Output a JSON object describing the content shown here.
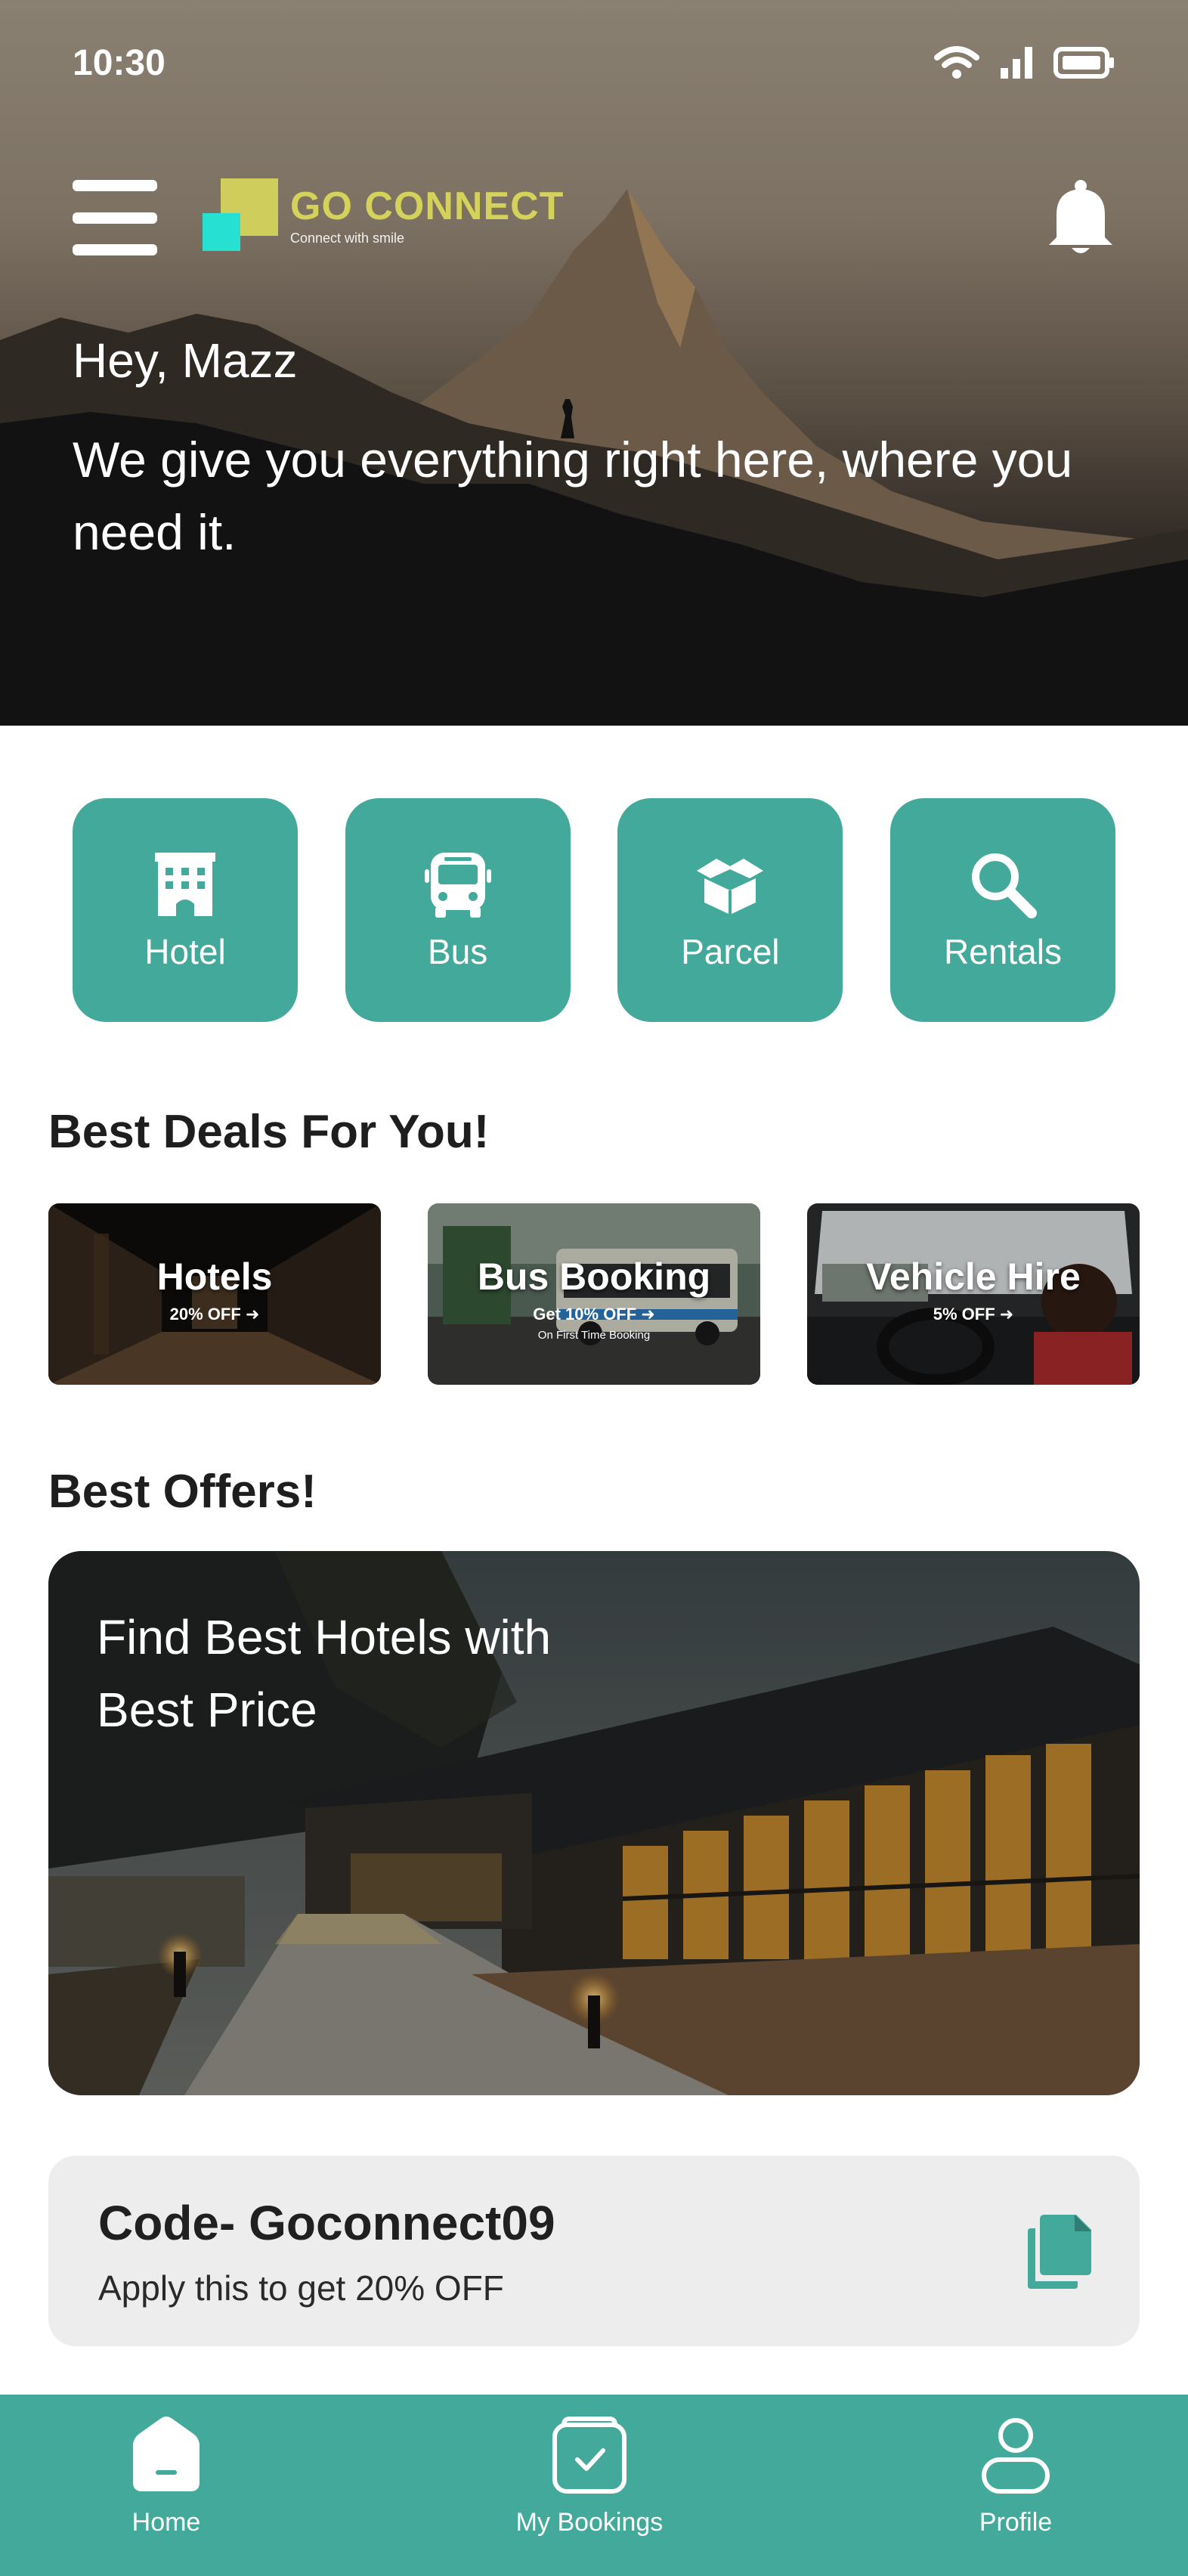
{
  "status_bar": {
    "time": "10:30",
    "icons": [
      "wifi-icon",
      "signal-icon",
      "battery-icon"
    ]
  },
  "header": {
    "logo": {
      "name": "GO CONNECT",
      "tagline": "Connect with smile"
    },
    "greeting": "Hey, Mazz",
    "tagline": "We give you everything right here, where you need it."
  },
  "services": [
    {
      "label": "Hotel",
      "icon": "hotel-icon"
    },
    {
      "label": "Bus",
      "icon": "bus-icon"
    },
    {
      "label": "Parcel",
      "icon": "parcel-icon"
    },
    {
      "label": "Rentals",
      "icon": "search-icon"
    }
  ],
  "deals": {
    "title": "Best Deals For You!",
    "items": [
      {
        "title": "Hotels",
        "subtitle": "20% OFF",
        "note": ""
      },
      {
        "title": "Bus Booking",
        "subtitle": "Get 10% OFF",
        "note": "On First Time Booking"
      },
      {
        "title": "Vehicle Hire",
        "subtitle": "5% OFF",
        "note": ""
      }
    ]
  },
  "offers": {
    "title": "Best Offers!",
    "banner_text": "Find Best Hotels with Best Price"
  },
  "coupon": {
    "code": "Code- Goconnect09",
    "description": "Apply this to get 20% OFF"
  },
  "bottom_nav": [
    {
      "label": "Home",
      "icon": "home-icon",
      "active": true
    },
    {
      "label": "My Bookings",
      "icon": "bookings-icon",
      "active": false
    },
    {
      "label": "Profile",
      "icon": "profile-icon",
      "active": false
    }
  ],
  "colors": {
    "accent": "#43a99b",
    "logo_yellow": "#d4d25a",
    "logo_cyan": "#26e0d2",
    "coupon_bg": "#ededed"
  }
}
